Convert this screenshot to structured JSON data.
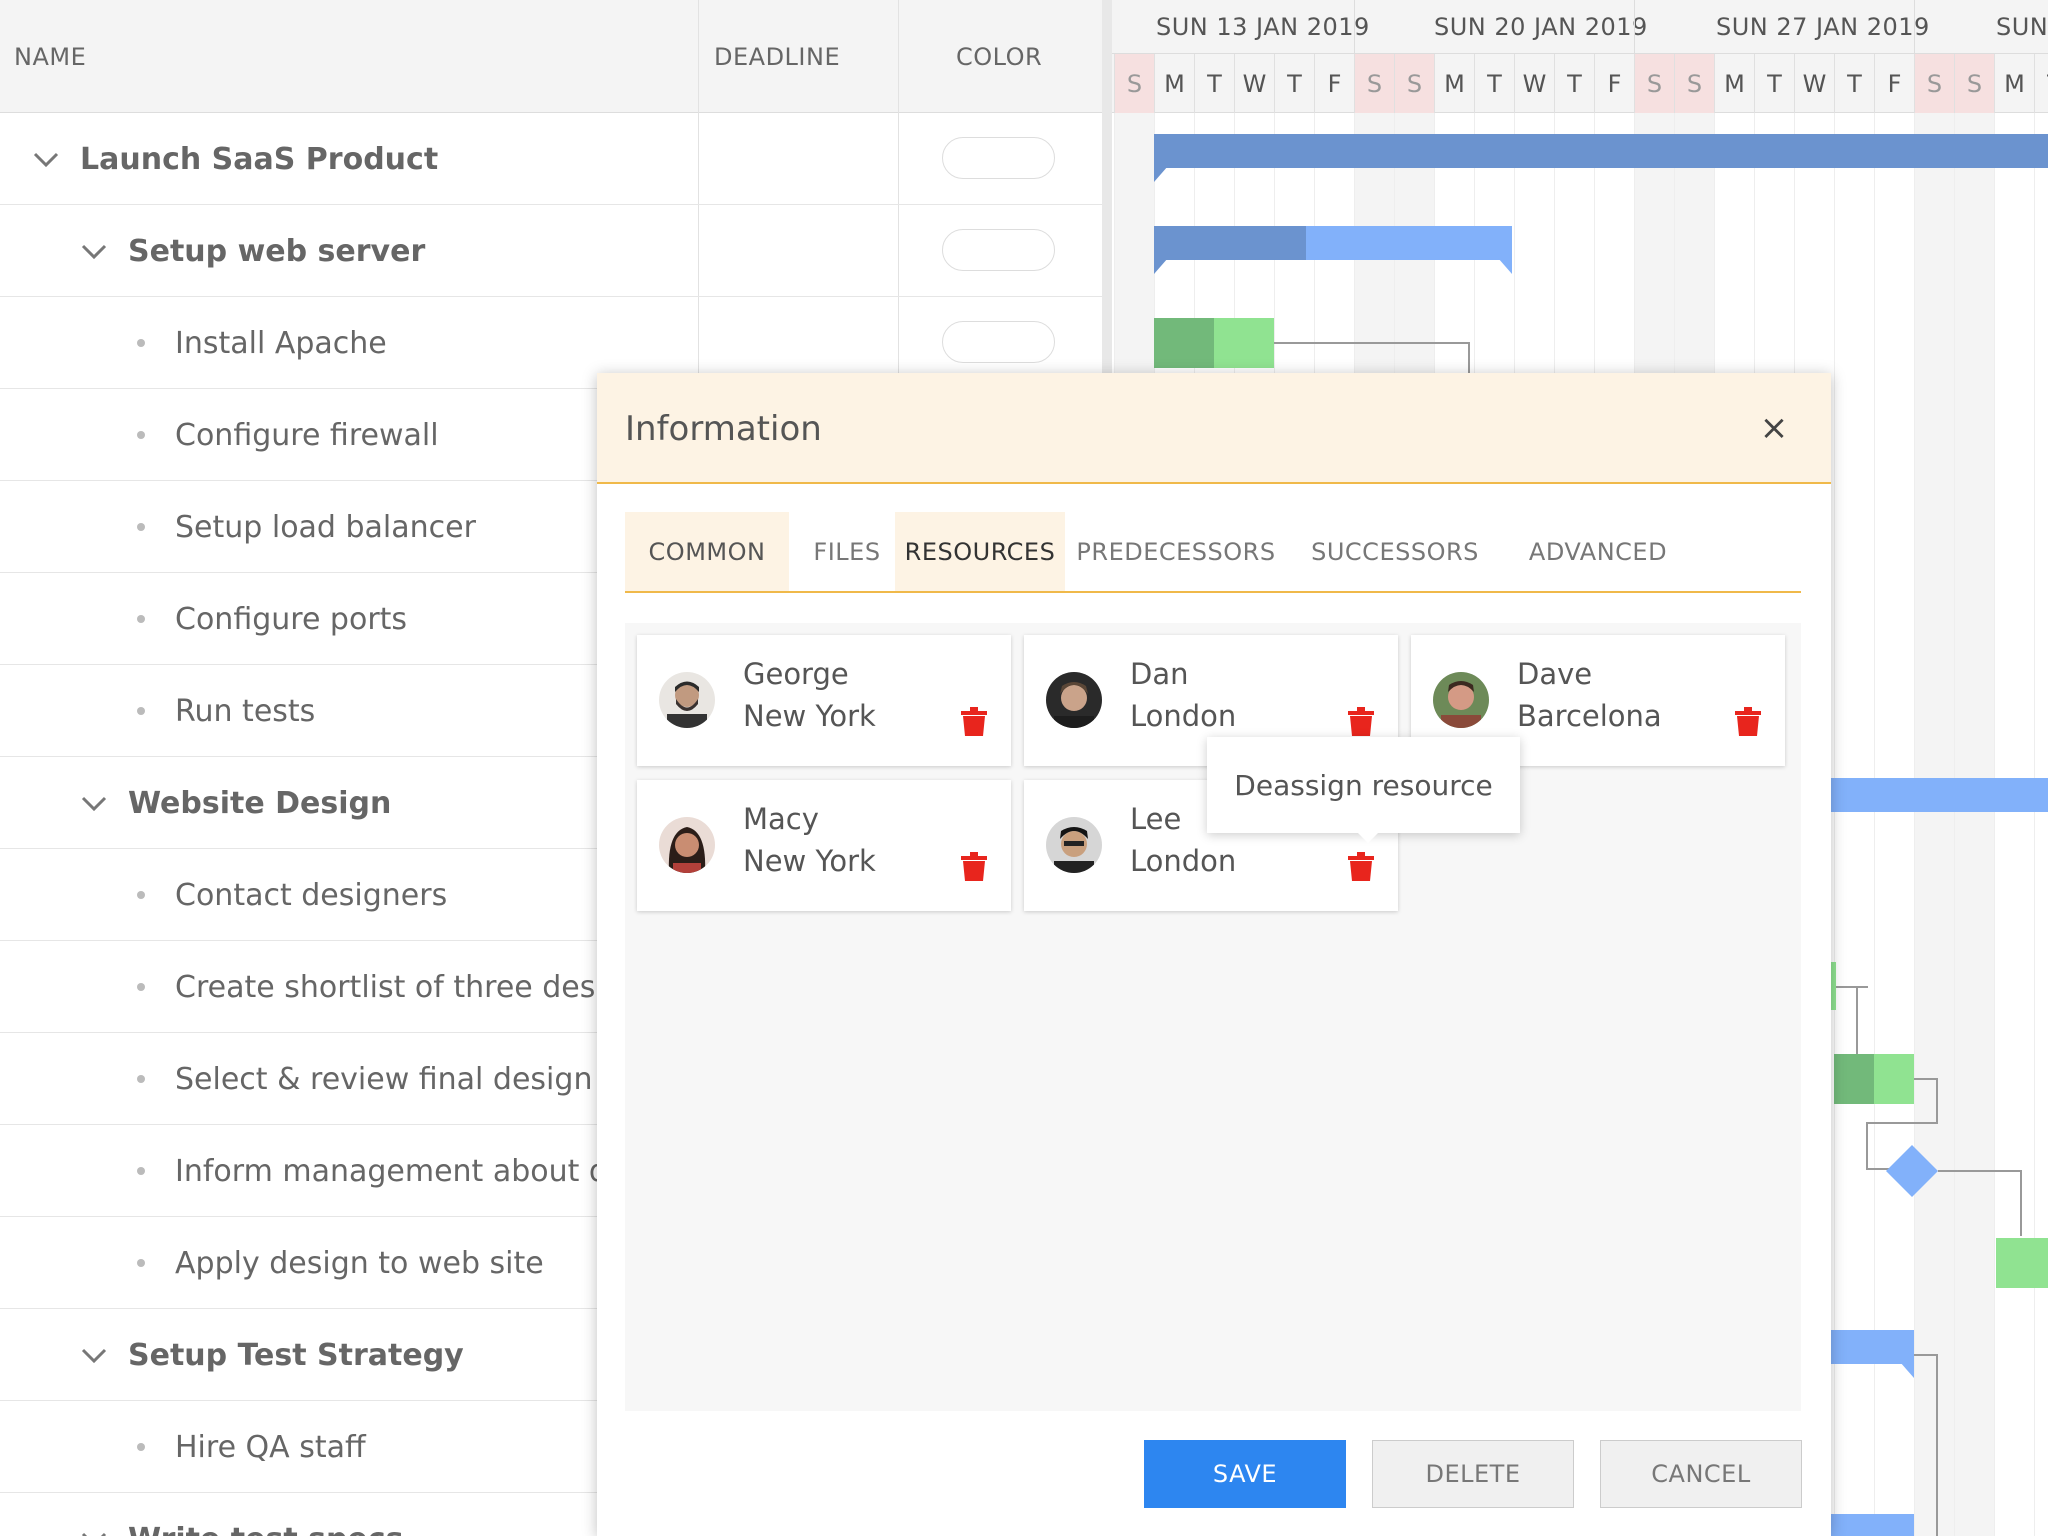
{
  "grid": {
    "columns": {
      "name": "NAME",
      "deadline": "DEADLINE",
      "color": "COLOR"
    },
    "rows": [
      {
        "label": "Launch SaaS Product",
        "level": 0,
        "group": true,
        "color_pill": true
      },
      {
        "label": "Setup web server",
        "level": 1,
        "group": true,
        "color_pill": true
      },
      {
        "label": "Install Apache",
        "level": 2,
        "group": false,
        "color_pill": true
      },
      {
        "label": "Configure firewall",
        "level": 2,
        "group": false
      },
      {
        "label": "Setup load balancer",
        "level": 2,
        "group": false
      },
      {
        "label": "Configure ports",
        "level": 2,
        "group": false
      },
      {
        "label": "Run tests",
        "level": 2,
        "group": false
      },
      {
        "label": "Website Design",
        "level": 1,
        "group": true
      },
      {
        "label": "Contact designers",
        "level": 2,
        "group": false
      },
      {
        "label": "Create shortlist of three designers",
        "level": 2,
        "group": false
      },
      {
        "label": "Select & review final design",
        "level": 2,
        "group": false
      },
      {
        "label": "Inform management about decision",
        "level": 2,
        "group": false
      },
      {
        "label": "Apply design to web site",
        "level": 2,
        "group": false
      },
      {
        "label": "Setup Test Strategy",
        "level": 1,
        "group": true
      },
      {
        "label": "Hire QA staff",
        "level": 2,
        "group": false
      },
      {
        "label": "Write test specs",
        "level": 1,
        "group": true
      }
    ]
  },
  "timeline": {
    "weeks": [
      "SUN 13 JAN 2019",
      "SUN 20 JAN 2019",
      "SUN 27 JAN 2019",
      "SUN"
    ],
    "days": [
      "S",
      "M",
      "T",
      "W",
      "T",
      "F",
      "S",
      "S",
      "M",
      "T",
      "W",
      "T",
      "F",
      "S",
      "S",
      "M",
      "T",
      "W",
      "T",
      "F",
      "S",
      "S",
      "M",
      "T"
    ]
  },
  "dialog": {
    "title": "Information",
    "close_label": "×",
    "tabs": [
      "COMMON",
      "FILES",
      "RESOURCES",
      "PREDECESSORS",
      "SUCCESSORS",
      "ADVANCED"
    ],
    "active_tab": "RESOURCES",
    "resources": [
      {
        "name": "George",
        "city": "New York"
      },
      {
        "name": "Dan",
        "city": "London"
      },
      {
        "name": "Dave",
        "city": "Barcelona"
      },
      {
        "name": "Macy",
        "city": "New York"
      },
      {
        "name": "Lee",
        "city": "London"
      }
    ],
    "tooltip": "Deassign resource",
    "buttons": {
      "save": "SAVE",
      "delete": "DELETE",
      "cancel": "CANCEL"
    }
  },
  "colors": {
    "accent": "#f0b94a",
    "primary_button": "#2d86f0",
    "trash": "#e8251d",
    "bar_blue_dark": "#6b93cf",
    "bar_blue_light": "#82b1fa",
    "bar_green_dark": "#72b97a",
    "bar_green_light": "#90e391"
  }
}
